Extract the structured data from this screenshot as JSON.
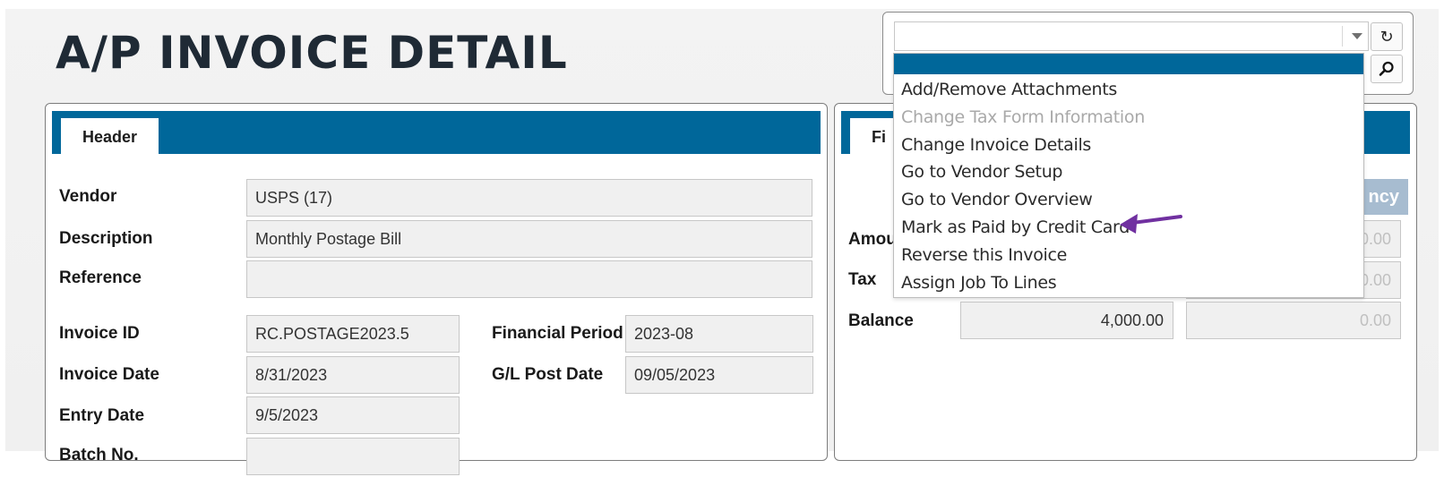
{
  "page": {
    "title": "A/P INVOICE DETAIL"
  },
  "header_panel": {
    "tab_label": "Header",
    "fields": {
      "vendor": {
        "label": "Vendor",
        "value": "USPS (17)"
      },
      "description": {
        "label": "Description",
        "value": "Monthly Postage Bill"
      },
      "reference": {
        "label": "Reference",
        "value": ""
      },
      "invoice_id": {
        "label": "Invoice ID",
        "value": "RC.POSTAGE2023.5"
      },
      "financial_period": {
        "label": "Financial Period",
        "value": "2023-08"
      },
      "invoice_date": {
        "label": "Invoice Date",
        "value": "8/31/2023"
      },
      "gl_post_date": {
        "label": "G/L Post Date",
        "value": "09/05/2023"
      },
      "entry_date": {
        "label": "Entry Date",
        "value": "9/5/2023"
      },
      "partial_label": "Batch No.",
      "partial_value": ""
    }
  },
  "financial_panel": {
    "tab_label_partial": "Fi",
    "currency_header_partial": "ncy",
    "rows": {
      "amount": {
        "label_partial": "Amou",
        "foreign_value_partial": "0.00"
      },
      "tax": {
        "label": "Tax",
        "foreign_value_partial": "0.00"
      },
      "balance": {
        "label": "Balance",
        "value": "4,000.00",
        "foreign_value": "0.00"
      }
    }
  },
  "actions": {
    "selected_value": "",
    "menu_items": [
      {
        "label": "Add/Remove Attachments",
        "enabled": true
      },
      {
        "label": "Change Tax Form Information",
        "enabled": false
      },
      {
        "label": "Change Invoice Details",
        "enabled": true
      },
      {
        "label": "Go to Vendor Setup",
        "enabled": true
      },
      {
        "label": "Go to Vendor Overview",
        "enabled": true
      },
      {
        "label": "Mark as Paid by Credit Card",
        "enabled": true
      },
      {
        "label": "Reverse this Invoice",
        "enabled": true
      },
      {
        "label": "Assign Job To Lines",
        "enabled": true
      }
    ],
    "refresh_icon": "refresh-icon",
    "search_icon": "search-icon"
  },
  "colors": {
    "accent": "#00679a",
    "currency_header": "#a7bcd0",
    "annotation_arrow": "#7030a0",
    "disabled_text": "#a9a9a9"
  }
}
